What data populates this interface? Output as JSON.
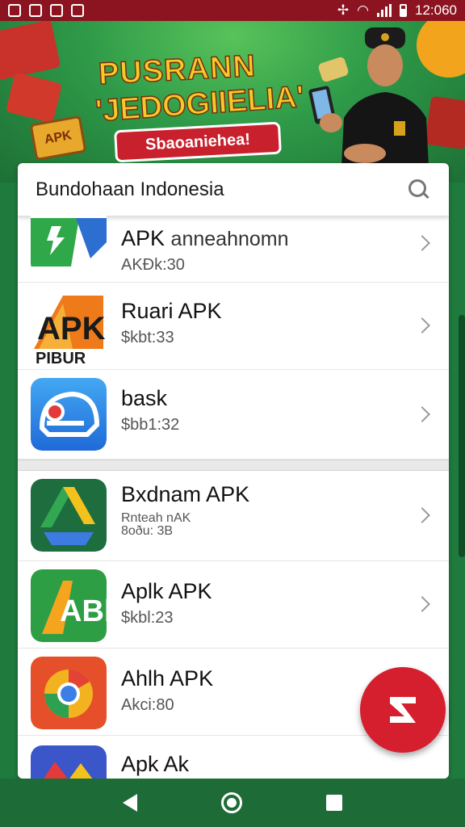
{
  "status_bar": {
    "time": "12:060"
  },
  "banner": {
    "title_line1": "PUSRANN",
    "title_line2": "'JEDOGIIELIA'",
    "pill_label": "Sbaoaniehea!",
    "crate_label": "APK"
  },
  "search": {
    "label": "Bundohaan Indonesia",
    "icon": "search-icon"
  },
  "apps": [
    {
      "title": "APK",
      "subtitle": "anneahnomn",
      "meta": "AKĐk:30",
      "icon_colors": [
        "#1f9a3c",
        "#2f6fd1"
      ]
    },
    {
      "title": "Ruari APK",
      "meta": "$kbt:33",
      "icon_text": "APK",
      "icon_sub": "PIBUR"
    },
    {
      "title": "bask",
      "meta": "$bb1:32"
    },
    {
      "title": "Bxdnam APK",
      "meta_line1": "Rnteah nAK",
      "meta_line2": "8oðu: 3B"
    },
    {
      "title": "Aplk APK",
      "meta": "$kbl:23",
      "icon_text": "ABk"
    },
    {
      "title": "Ahlh APK",
      "meta": "Akci:80"
    },
    {
      "title": "Apk Ak"
    }
  ],
  "fab": {
    "icon": "apk-fab-icon",
    "color": "#d61f2e"
  },
  "nav": {
    "back": "back-icon",
    "home": "home-icon",
    "recent": "recent-icon"
  },
  "colors": {
    "status_bar": "#8c1420",
    "nav_bar": "#1d6b36",
    "accent_red": "#c8202c"
  }
}
